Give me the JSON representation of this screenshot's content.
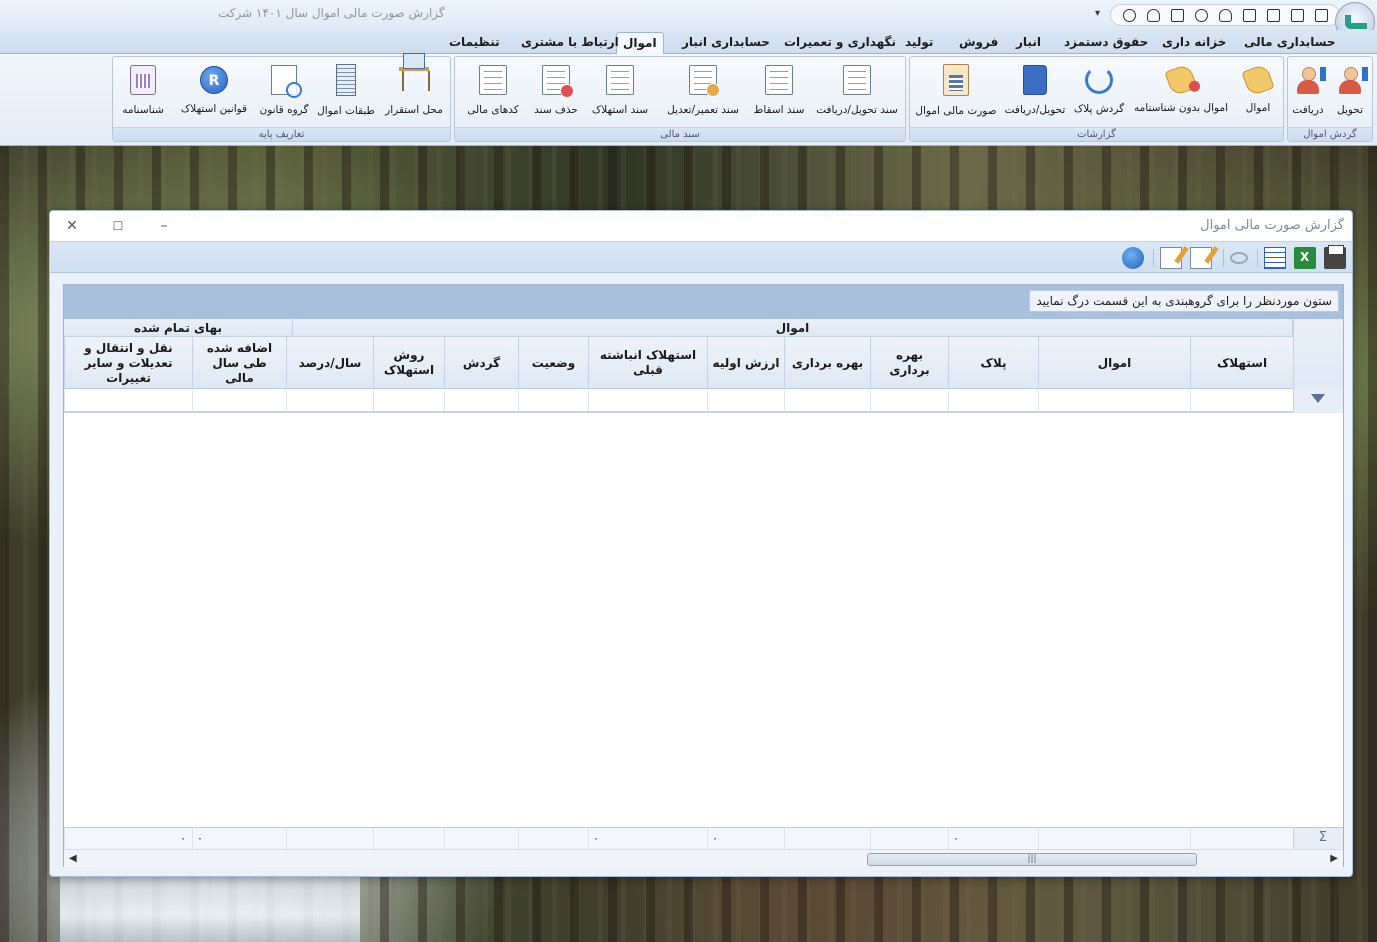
{
  "app": {
    "title": "گزارش صورت مالی اموال   سال ۱۴۰۱ شرکت"
  },
  "ribbon": {
    "tabs": [
      {
        "label": "حسابداری مالی"
      },
      {
        "label": "خزانه داری"
      },
      {
        "label": "حقوق دستمزد"
      },
      {
        "label": "انبار"
      },
      {
        "label": "فروش"
      },
      {
        "label": "تولید"
      },
      {
        "label": "نگهداری و تعمیرات"
      },
      {
        "label": "حسابداری انبار"
      },
      {
        "label": "اموال"
      },
      {
        "label": "ارتباط با مشتری"
      },
      {
        "label": "تنظیمات"
      }
    ],
    "active_tab": "اموال",
    "groups": {
      "assets_flow": {
        "label": "گردش اموال",
        "buttons": [
          {
            "label": "تحویل"
          },
          {
            "label": "دریافت"
          }
        ]
      },
      "reports": {
        "label": "گزارشات",
        "buttons": [
          {
            "label": "اموال"
          },
          {
            "label": "اموال بدون شناسنامه"
          },
          {
            "label": "گردش پلاک"
          },
          {
            "label": "تحویل/دریافت"
          },
          {
            "label": "صورت مالی اموال"
          }
        ]
      },
      "financial_doc": {
        "label": "سند مالی",
        "buttons": [
          {
            "label": "سند تحویل/دریافت"
          },
          {
            "label": "سند اسقاط"
          },
          {
            "label": "سند تعمیر/تعدیل"
          },
          {
            "label": "سند استهلاک"
          },
          {
            "label": "حذف سند"
          },
          {
            "label": "کدهای مالی"
          }
        ]
      },
      "base_definitions": {
        "label": "تعاریف پایه",
        "buttons": [
          {
            "label": "محل استقرار"
          },
          {
            "label": "طبقات اموال"
          },
          {
            "label": "گروه قانون"
          },
          {
            "label": "قوانین استهلاک"
          },
          {
            "label": "شناسنامه"
          }
        ]
      }
    }
  },
  "window": {
    "title": "گزارش صورت مالی اموال",
    "controls": {
      "minimize": "–",
      "maximize": "☐",
      "close": "✕"
    }
  },
  "grid": {
    "group_hint": "ستون موردنظر را برای گروهبندی به این قسمت درگ نمایید",
    "bands": {
      "assets": "اموال",
      "cost": "بهای تمام شده"
    },
    "columns": [
      {
        "label": "استهلاک"
      },
      {
        "label": "اموال"
      },
      {
        "label": "پلاک"
      },
      {
        "label": "بهره برداری"
      },
      {
        "label": "بهره برداری"
      },
      {
        "label": "ارزش اولیه"
      },
      {
        "label": "استهلاک انباشته قبلی"
      },
      {
        "label": "وضعیت"
      },
      {
        "label": "گردش"
      },
      {
        "label": "روش استهلاک"
      },
      {
        "label": "سال/درصد"
      },
      {
        "label": "اضافه شده طی سال مالی"
      },
      {
        "label": "نقل و انتقال و تعدیلات و سایر تغییرات"
      }
    ],
    "summary": {
      "plak": "۰",
      "initial_value": "۰",
      "accumulated": "۰",
      "added": "۰",
      "transfers": "۰"
    },
    "scroll_thumb": "|||"
  }
}
